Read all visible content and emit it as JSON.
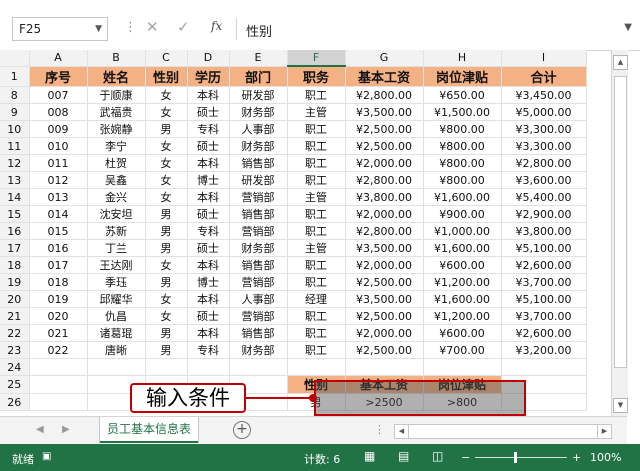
{
  "formula_bar": {
    "cell_ref": "F25",
    "content": "性别"
  },
  "columns": [
    "A",
    "B",
    "C",
    "D",
    "E",
    "F",
    "G",
    "H",
    "I"
  ],
  "selected_column": "F",
  "header_row": {
    "row_num": "1",
    "cells": [
      "序号",
      "姓名",
      "性别",
      "学历",
      "部门",
      "职务",
      "基本工资",
      "岗位津贴",
      "合计"
    ]
  },
  "rows": [
    {
      "row_num": "8",
      "cells": [
        "007",
        "于顺康",
        "女",
        "本科",
        "研发部",
        "职工",
        "¥2,800.00",
        "¥650.00",
        "¥3,450.00"
      ]
    },
    {
      "row_num": "9",
      "cells": [
        "008",
        "武福贵",
        "女",
        "硕士",
        "财务部",
        "主管",
        "¥3,500.00",
        "¥1,500.00",
        "¥5,000.00"
      ]
    },
    {
      "row_num": "10",
      "cells": [
        "009",
        "张婉静",
        "男",
        "专科",
        "人事部",
        "职工",
        "¥2,500.00",
        "¥800.00",
        "¥3,300.00"
      ]
    },
    {
      "row_num": "11",
      "cells": [
        "010",
        "李宁",
        "女",
        "硕士",
        "财务部",
        "职工",
        "¥2,500.00",
        "¥800.00",
        "¥3,300.00"
      ]
    },
    {
      "row_num": "12",
      "cells": [
        "011",
        "杜贺",
        "女",
        "本科",
        "销售部",
        "职工",
        "¥2,000.00",
        "¥800.00",
        "¥2,800.00"
      ]
    },
    {
      "row_num": "13",
      "cells": [
        "012",
        "吴鑫",
        "女",
        "博士",
        "研发部",
        "职工",
        "¥2,800.00",
        "¥800.00",
        "¥3,600.00"
      ]
    },
    {
      "row_num": "14",
      "cells": [
        "013",
        "金兴",
        "女",
        "本科",
        "营销部",
        "主管",
        "¥3,800.00",
        "¥1,600.00",
        "¥5,400.00"
      ]
    },
    {
      "row_num": "15",
      "cells": [
        "014",
        "沈安坦",
        "男",
        "硕士",
        "销售部",
        "职工",
        "¥2,000.00",
        "¥900.00",
        "¥2,900.00"
      ]
    },
    {
      "row_num": "16",
      "cells": [
        "015",
        "苏新",
        "男",
        "专科",
        "营销部",
        "职工",
        "¥2,800.00",
        "¥1,000.00",
        "¥3,800.00"
      ]
    },
    {
      "row_num": "17",
      "cells": [
        "016",
        "丁兰",
        "男",
        "硕士",
        "财务部",
        "主管",
        "¥3,500.00",
        "¥1,600.00",
        "¥5,100.00"
      ]
    },
    {
      "row_num": "18",
      "cells": [
        "017",
        "王达刚",
        "女",
        "本科",
        "销售部",
        "职工",
        "¥2,000.00",
        "¥600.00",
        "¥2,600.00"
      ]
    },
    {
      "row_num": "19",
      "cells": [
        "018",
        "季珏",
        "男",
        "博士",
        "营销部",
        "职工",
        "¥2,500.00",
        "¥1,200.00",
        "¥3,700.00"
      ]
    },
    {
      "row_num": "20",
      "cells": [
        "019",
        "邱耀华",
        "女",
        "本科",
        "人事部",
        "经理",
        "¥3,500.00",
        "¥1,600.00",
        "¥5,100.00"
      ]
    },
    {
      "row_num": "21",
      "cells": [
        "020",
        "仇昌",
        "女",
        "硕士",
        "营销部",
        "职工",
        "¥2,500.00",
        "¥1,200.00",
        "¥3,700.00"
      ]
    },
    {
      "row_num": "22",
      "cells": [
        "021",
        "诸葛琨",
        "男",
        "本科",
        "销售部",
        "职工",
        "¥2,000.00",
        "¥600.00",
        "¥2,600.00"
      ]
    },
    {
      "row_num": "23",
      "cells": [
        "022",
        "唐晰",
        "男",
        "专科",
        "财务部",
        "职工",
        "¥2,500.00",
        "¥700.00",
        "¥3,200.00"
      ]
    }
  ],
  "empty_row": "24",
  "criteria": {
    "header_row_num": "25",
    "value_row_num": "26",
    "headers": [
      "性别",
      "基本工资",
      "岗位津贴"
    ],
    "values": [
      "男",
      ">2500",
      ">800"
    ]
  },
  "callout": "输入条件",
  "sheet_tab": "员工基本信息表",
  "status": {
    "ready": "就绪",
    "count": "计数: 6",
    "zoom": "100%"
  },
  "colors": {
    "header_fill": "#f4b183",
    "excel_green": "#217346",
    "callout_red": "#c00000"
  }
}
